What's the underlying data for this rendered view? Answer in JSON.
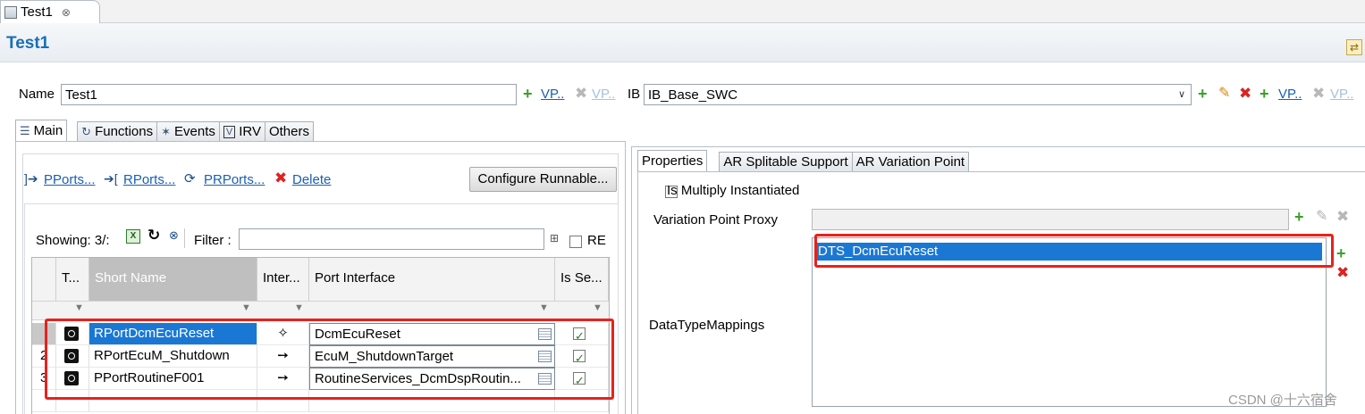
{
  "editor_tab": {
    "label": "Test1",
    "close": "⊗"
  },
  "form": {
    "title": "Test1",
    "sync_icon": "⇄"
  },
  "name_row": {
    "name_label": "Name",
    "name_value": "Test1",
    "vp_link": "VP..",
    "vp_link_disabled": "VP..",
    "ib_label": "IB",
    "ib_value": "IB_Base_SWC",
    "ib_combo_arrow": "∨",
    "ib_vp_link": "VP..",
    "ib_vp_link_disabled": "VP.."
  },
  "main_tabs": [
    {
      "label": "Main",
      "icon": "☰"
    },
    {
      "label": "Functions",
      "icon": "↻"
    },
    {
      "label": "Events",
      "icon": "✶"
    },
    {
      "label": "IRV",
      "icon": "V"
    },
    {
      "label": "Others",
      "icon": ""
    }
  ],
  "ports_toolbar": {
    "pports": "PPorts...",
    "rports": "RPorts...",
    "prports": "PRPorts...",
    "delete": "Delete",
    "configure_runnable": "Configure Runnable..."
  },
  "table_toolbar": {
    "showing": "Showing: 3/:",
    "filter_label": "Filter :",
    "filter_value": "",
    "re_label": "RE"
  },
  "table": {
    "columns": [
      "T...",
      "Short Name",
      "Inter...",
      "Port Interface",
      "Is Se..."
    ],
    "rows": [
      {
        "num": "",
        "short_name": "RPortDcmEcuReset",
        "inter": "✧",
        "port_interface": "DcmEcuReset",
        "is_service": true
      },
      {
        "num": "2",
        "short_name": "RPortEcuM_Shutdown",
        "inter": "➙",
        "port_interface": "EcuM_ShutdownTarget",
        "is_service": true
      },
      {
        "num": "3",
        "short_name": "PPortRoutineF001",
        "inter": "➙",
        "port_interface": "RoutineServices_DcmDspRoutin...",
        "is_service": true
      }
    ]
  },
  "right_tabs": [
    "Properties",
    "AR Splitable Support",
    "AR Variation Point"
  ],
  "properties": {
    "is_multiply_instantiated": "Is Multiply Instantiated",
    "variation_point_proxy_label": "Variation Point Proxy",
    "variation_point_proxy_value": "",
    "datatype_mappings_label": "DataTypeMappings",
    "datatype_mappings": [
      "DTS_DcmEcuReset"
    ]
  },
  "watermark": "CSDN @十六宿舍",
  "colors": {
    "accent": "#1a78d4",
    "title": "#1a6fb4",
    "highlight_box": "#e8221b"
  }
}
